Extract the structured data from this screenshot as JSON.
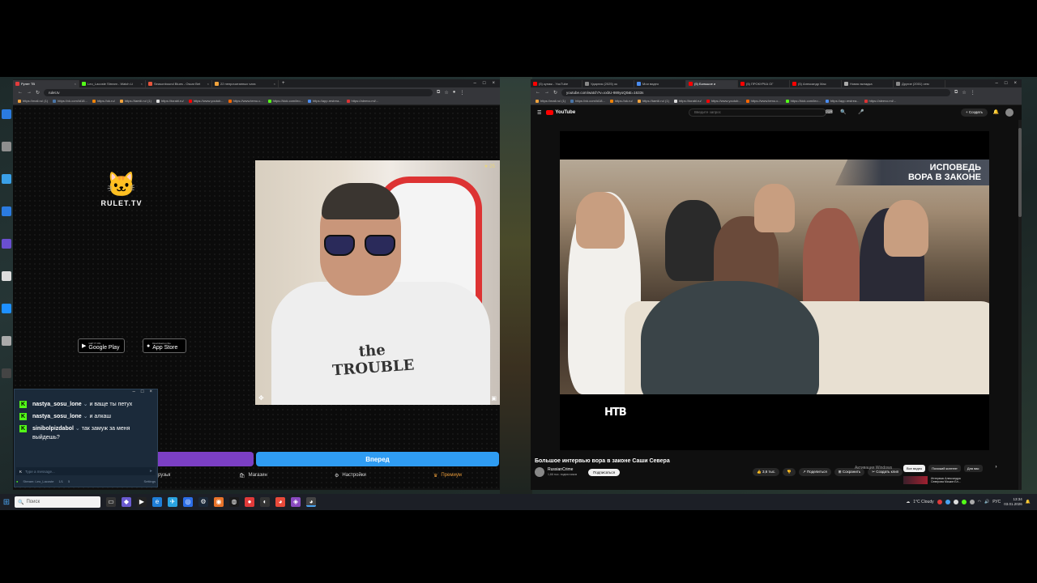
{
  "left_browser": {
    "tabs": [
      {
        "label": "Рулет ТВ",
        "color": "#e23c3c",
        "active": true
      },
      {
        "label": "Leo_Lacoste Stream - Watch Li",
        "color": "#53fc18"
      },
      {
        "label": "Seasonbound Blues - Oscar Bet",
        "color": "#e8553c"
      },
      {
        "label": "22 непрочитанных чата",
        "color": "#f1a33c"
      }
    ],
    "url": "rulet.tv",
    "bookmarks": [
      "https://mail.ru/ (1)",
      "https://vk.com/id18...",
      "https://ok.ru/",
      "https://tamiii.ru/ (1)",
      "https://torabl.ru/",
      "https://www.youtub...",
      "https://www.temu.c...",
      "https://kick.com/leo...",
      "https://app.restrea...",
      "https://aleevo.ml/..."
    ]
  },
  "rulet": {
    "logo_text": "RULET.TV",
    "google_play_small": "GET IT ON",
    "google_play": "Google Play",
    "app_store_small": "Download on the",
    "app_store": "App Store",
    "cam_badge": "★ 25",
    "shirt_text": "the TROUBLE",
    "button_label": "Вперед",
    "nav": [
      "рузья",
      "Магазин",
      "Настройки",
      "Премиум"
    ]
  },
  "chat": {
    "messages": [
      {
        "user": "nastya_sosu_lone",
        "text": "и ваще ты петух"
      },
      {
        "user": "nastya_sosu_lone",
        "text": "и алкаш"
      },
      {
        "user": "sinibolpizdabol",
        "text": "так замуж за меня выйдешь?"
      }
    ],
    "input_placeholder": "Type a message...",
    "footer": "Stream: Leo_Lacoste",
    "footer_counts": [
      "1/1",
      "5"
    ],
    "settings": "Settings"
  },
  "right_browser": {
    "tabs": [
      {
        "label": "(5) купаж - YouTube",
        "color": "#f00"
      },
      {
        "label": "Ударник (2025) ок",
        "color": "#888"
      },
      {
        "label": "Мои видео",
        "color": "#4a8cf0"
      },
      {
        "label": "(5) Большое и",
        "color": "#f00",
        "active": true
      },
      {
        "label": "(5) ПРОКУРКА ОГ",
        "color": "#f00"
      },
      {
        "label": "(5) Александр Мас",
        "color": "#f00"
      },
      {
        "label": "Новая вкладка",
        "color": "#aaa"
      },
      {
        "label": "Другие (2001) сем",
        "color": "#888"
      }
    ],
    "url": "youtube.com/watch?v=xxbU-989yoQ0&t=1633s",
    "bookmarks": [
      "https://mail.ru/ (1)",
      "https://vk.com/id18...",
      "https://ok.ru/",
      "https://tamiii.ru/ (1)",
      "https://torabl.ru/",
      "https://www.youtub...",
      "https://www.temu.c...",
      "https://kick.com/leo...",
      "https://app.restrea...",
      "https://aleevo.ml/..."
    ]
  },
  "youtube": {
    "logo": "YouTube",
    "search_placeholder": "Введите запрос",
    "create": "+ Создать",
    "caption_line1": "ИСПОВЕДЬ",
    "caption_line2": "ВОРА В ЗАКОНЕ",
    "channel_logo": "НТВ",
    "title": "Большое интервью вора в законе Саши Севера",
    "channel": "RussianCrime",
    "subscribers": "1,66 тыс. подписчиков",
    "subscribe": "Подписаться",
    "likes": "3,6 тыс.",
    "share": "Поделиться",
    "save": "Сохранить",
    "clip": "Создать клип",
    "activation": "Активация Windows",
    "chips": [
      "Все видео",
      "Похожий контент",
      "Для вас"
    ],
    "side_title": "Интервью Александра",
    "side_sub": "Северова Мишин Бл..."
  },
  "taskbar": {
    "search": "Поиск",
    "weather": "1°C Cloudy",
    "lang": "РУС",
    "time": "13:34",
    "date": "03.01.2026"
  }
}
